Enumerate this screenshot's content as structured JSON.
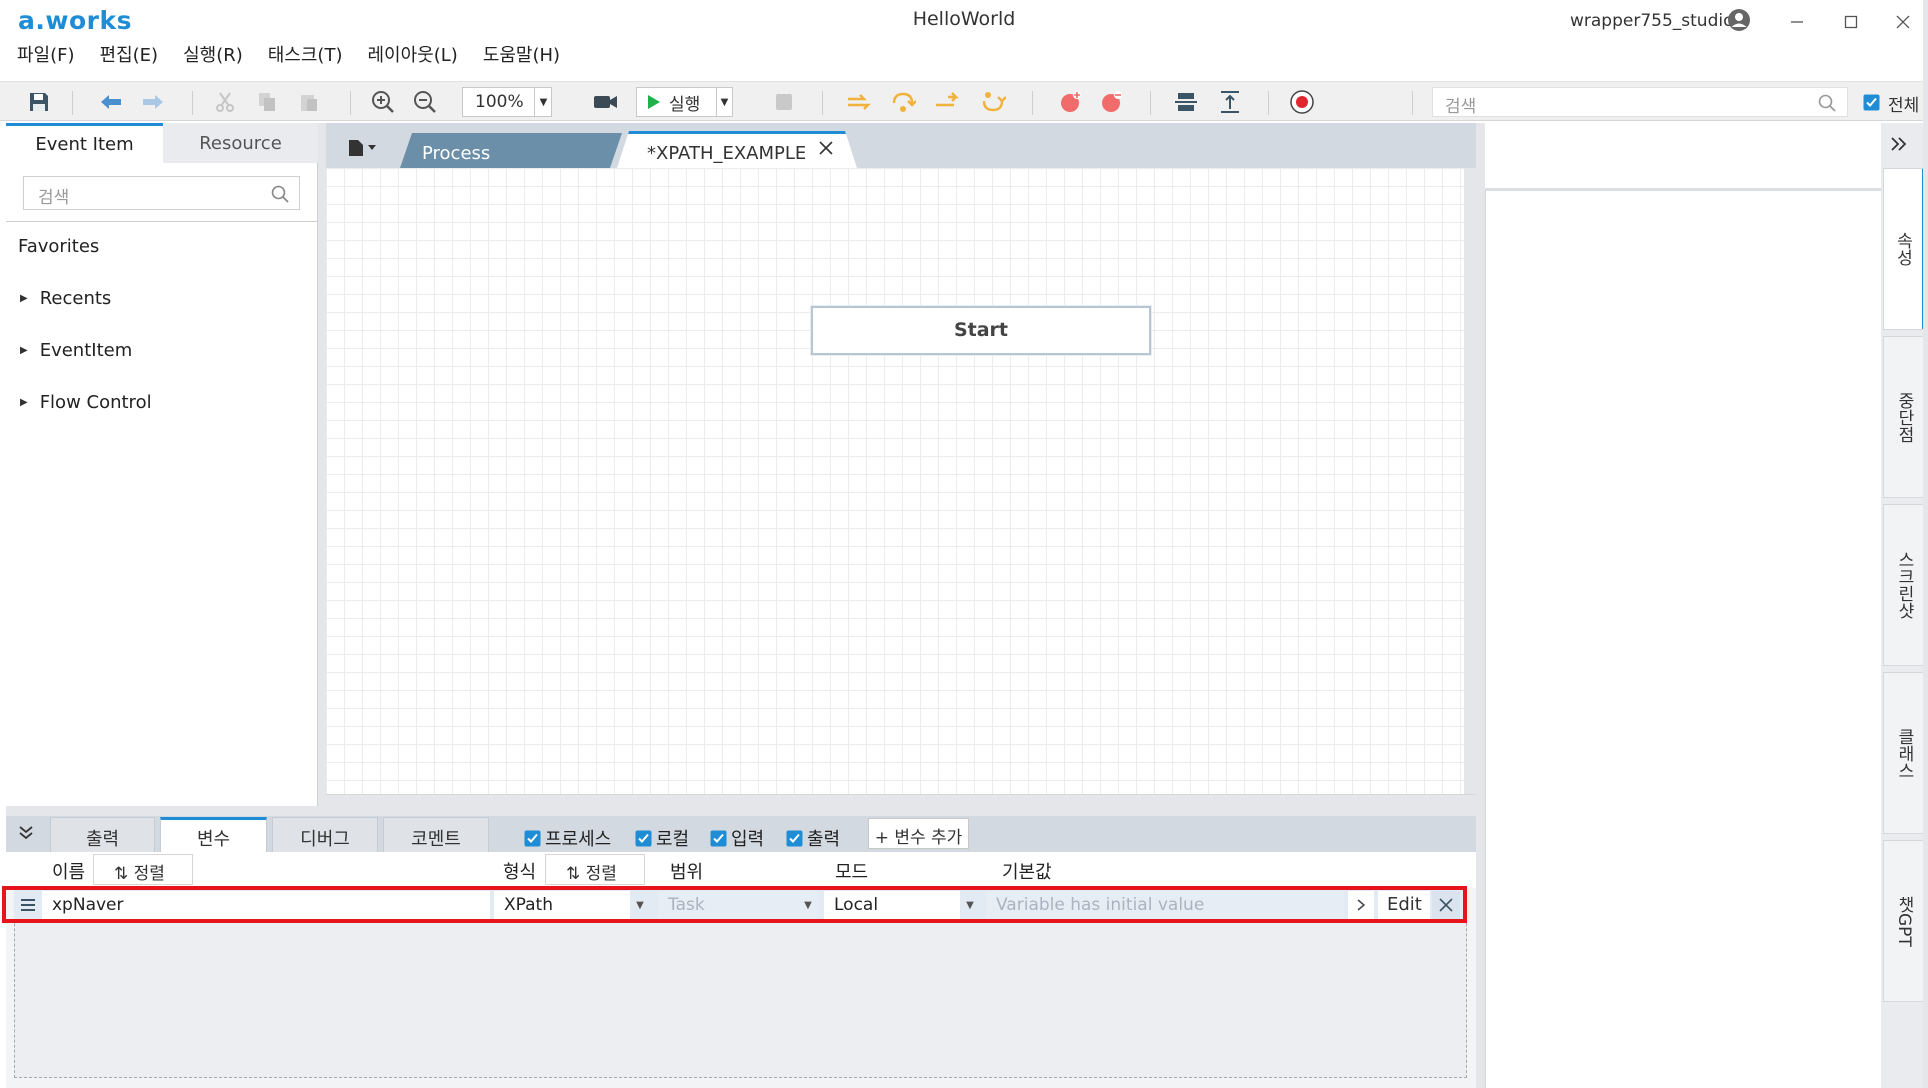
{
  "titlebar": {
    "logo": "a.works",
    "title": "HelloWorld",
    "user": "wrapper755_studio"
  },
  "menu": [
    "파일(F)",
    "편집(E)",
    "실행(R)",
    "태스크(T)",
    "레이아웃(L)",
    "도움말(H)"
  ],
  "toolbar": {
    "zoom": "100%",
    "run_label": "실행",
    "search_placeholder": "검색",
    "all_label": "전체",
    "all_checked": true
  },
  "left_panel": {
    "tabs": [
      "Event Item",
      "Resource"
    ],
    "search_placeholder": "검색",
    "favorites": "Favorites",
    "tree": [
      "Recents",
      "EventItem",
      "Flow Control"
    ]
  },
  "editor": {
    "tabs": [
      "Process",
      "*XPATH_EXAMPLE"
    ],
    "start_node": "Start"
  },
  "bottom_panel": {
    "tabs": [
      "출력",
      "변수",
      "디버그",
      "코멘트"
    ],
    "active_tab": "변수",
    "filters": [
      {
        "label": "프로세스",
        "checked": true
      },
      {
        "label": "로컬",
        "checked": true
      },
      {
        "label": "입력",
        "checked": true
      },
      {
        "label": "출력",
        "checked": true
      }
    ],
    "add_variable": "+ 변수 추가",
    "headers": {
      "name": "이름",
      "sort": "정렬",
      "type": "형식",
      "scope": "범위",
      "mode": "모드",
      "default": "기본값"
    },
    "rows": [
      {
        "name": "xpNaver",
        "type": "XPath",
        "scope": "Task",
        "mode": "Local",
        "default_placeholder": "Variable has initial value",
        "edit": "Edit"
      }
    ]
  },
  "side_tabs": [
    "속성",
    "중단점",
    "스크린샷",
    "클래스",
    "챗GPT"
  ],
  "colors": {
    "accent": "#1f8dd6",
    "highlight": "#e8141c",
    "process_tab": "#6b8fa8"
  }
}
